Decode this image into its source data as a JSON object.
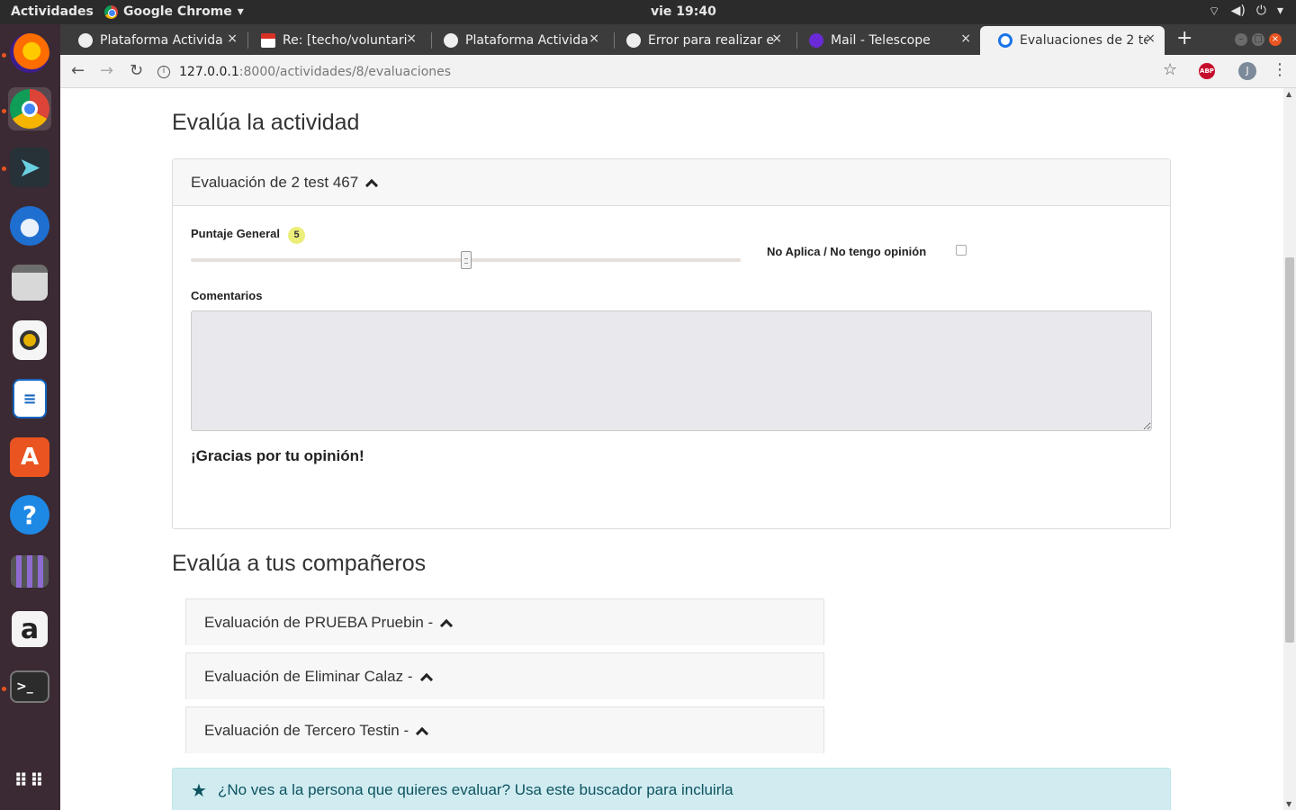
{
  "topbar": {
    "activities": "Actividades",
    "app_name": "Google Chrome",
    "app_arrow": "▾",
    "clock": "vie 19:40",
    "tray_icons": [
      "wifi-icon",
      "volume-icon",
      "power-icon"
    ],
    "tray_glyphs": [
      "⌔",
      "◀)",
      "⏻",
      "▾"
    ]
  },
  "dock": {
    "apps": [
      "firefox",
      "chrome",
      "remmina",
      "thunderbird",
      "files",
      "rhythmbox",
      "writer",
      "software",
      "help",
      "videos",
      "amazon",
      "terminal"
    ],
    "grid_label": "⋮⋮⋮"
  },
  "tabs": [
    {
      "label": "Plataforma Activida",
      "favicon": "github-icon",
      "color": "#ffffff"
    },
    {
      "label": "Re: [techo/voluntari",
      "favicon": "gmail-icon",
      "color": "#d93025"
    },
    {
      "label": "Plataforma Activida",
      "favicon": "github-icon",
      "color": "#ffffff"
    },
    {
      "label": "Error para realizar e",
      "favicon": "github-icon",
      "color": "#ffffff"
    },
    {
      "label": "Mail - Telescope",
      "favicon": "telescope-icon",
      "color": "#6a2bd6"
    },
    {
      "label": "Evaluaciones de 2 te",
      "favicon": "chrome-loading-icon",
      "color": "#1a73e8"
    }
  ],
  "tab_close": "×",
  "new_tab": "+",
  "address": {
    "host": "127.0.0.1",
    "path": ":8000/actividades/8/evaluaciones",
    "info_glyph": "i"
  },
  "nav": {
    "back": "←",
    "forward": "→",
    "reload": "↻",
    "star": "☆",
    "abp": "ABP",
    "avatar": "J",
    "menu": "⋮"
  },
  "page": {
    "activity_heading": "Evalúa la actividad",
    "activity_card": {
      "title": "Evaluación de 2 test 467",
      "score_label": "Puntaje General",
      "score_value": "5",
      "score_fraction": 0.5,
      "na_label": "No Aplica / No tengo opinión",
      "comments_label": "Comentarios",
      "comments_value": "",
      "thanks": "¡Gracias por tu opinión!"
    },
    "peers_heading": "Evalúa a tus compañeros",
    "peers": [
      {
        "title": "Evaluación de PRUEBA Pruebin -"
      },
      {
        "title": "Evaluación de Eliminar Calaz -"
      },
      {
        "title": "Evaluación de Tercero Testin -"
      }
    ],
    "alert": "¿No ves a la persona que quieres evaluar? Usa este buscador para incluirla"
  }
}
